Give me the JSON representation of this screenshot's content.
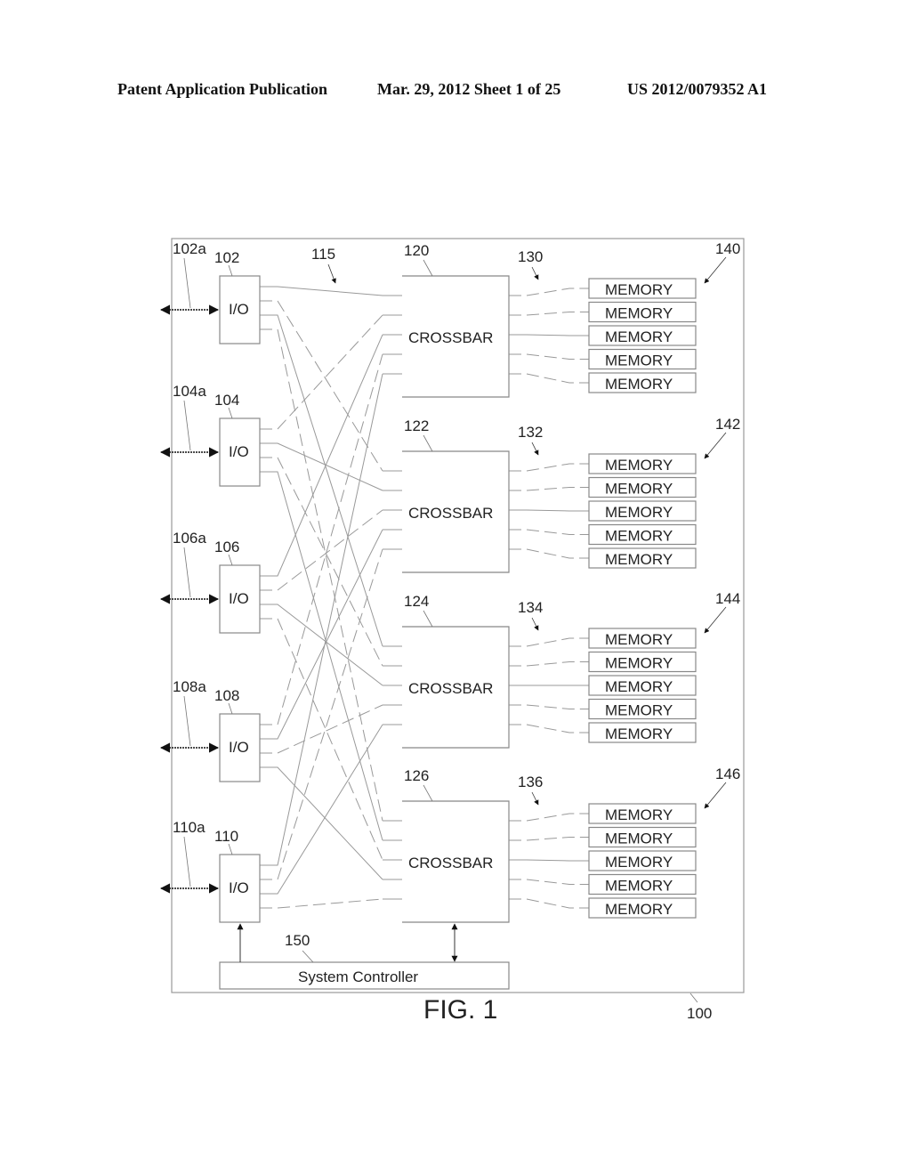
{
  "header": {
    "publication": "Patent Application Publication",
    "date_sheet": "Mar. 29, 2012  Sheet 1 of 25",
    "number": "US 2012/0079352 A1"
  },
  "figure": {
    "caption": "FIG. 1",
    "system_ref": "100",
    "interconnect_ref": "115",
    "io_modules": [
      {
        "ref": "102",
        "port_ref": "102a",
        "label": "I/O"
      },
      {
        "ref": "104",
        "port_ref": "104a",
        "label": "I/O"
      },
      {
        "ref": "106",
        "port_ref": "106a",
        "label": "I/O"
      },
      {
        "ref": "108",
        "port_ref": "108a",
        "label": "I/O"
      },
      {
        "ref": "110",
        "port_ref": "110a",
        "label": "I/O"
      }
    ],
    "crossbars": [
      {
        "ref": "120",
        "label": "CROSSBAR",
        "link_ref": "130",
        "memory_group_ref": "140",
        "memories": [
          "MEMORY",
          "MEMORY",
          "MEMORY",
          "MEMORY",
          "MEMORY"
        ]
      },
      {
        "ref": "122",
        "label": "CROSSBAR",
        "link_ref": "132",
        "memory_group_ref": "142",
        "memories": [
          "MEMORY",
          "MEMORY",
          "MEMORY",
          "MEMORY",
          "MEMORY"
        ]
      },
      {
        "ref": "124",
        "label": "CROSSBAR",
        "link_ref": "134",
        "memory_group_ref": "144",
        "memories": [
          "MEMORY",
          "MEMORY",
          "MEMORY",
          "MEMORY",
          "MEMORY"
        ]
      },
      {
        "ref": "126",
        "label": "CROSSBAR",
        "link_ref": "136",
        "memory_group_ref": "146",
        "memories": [
          "MEMORY",
          "MEMORY",
          "MEMORY",
          "MEMORY",
          "MEMORY"
        ]
      }
    ],
    "controller": {
      "ref": "150",
      "label": "System Controller"
    }
  }
}
